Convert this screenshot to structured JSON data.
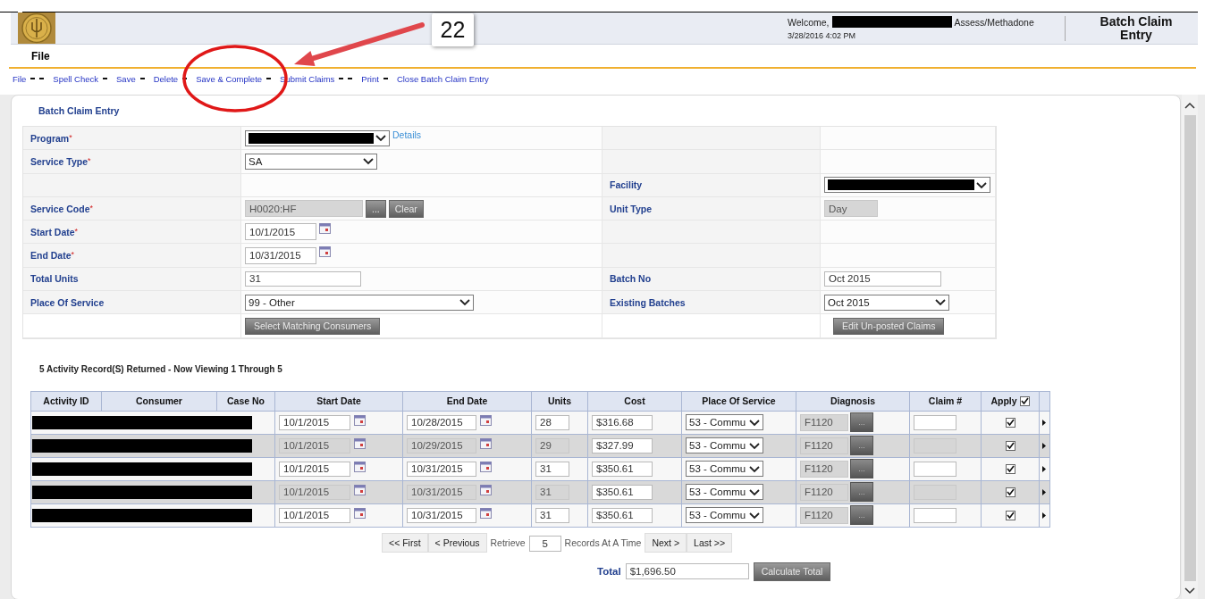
{
  "header": {
    "welcome": "Welcome,",
    "role": "Assess/Methadone",
    "datetime": "3/28/2016 4:02 PM",
    "page_title": "Batch Claim Entry"
  },
  "menu_bar": {
    "label": "File"
  },
  "toolbar": [
    {
      "label": "File",
      "kind": "double"
    },
    {
      "label": "Spell Check",
      "kind": "single"
    },
    {
      "label": "Save",
      "kind": "single"
    },
    {
      "label": "Delete",
      "kind": "single"
    },
    {
      "label": "Save & Complete",
      "kind": "single"
    },
    {
      "label": "Submit Claims",
      "kind": "double"
    },
    {
      "label": "Print",
      "kind": "single"
    },
    {
      "label": "Close Batch Claim Entry",
      "kind": "plain"
    }
  ],
  "annotation": {
    "callout": "22"
  },
  "form": {
    "title": "Batch Claim Entry",
    "rows": [
      {
        "left": {
          "label": "Program",
          "required_mark": "*",
          "control": {
            "kind": "redacted-select",
            "link": "Details"
          }
        }
      },
      {
        "left": {
          "label": "Service Type",
          "required_mark": "*",
          "control": {
            "kind": "select",
            "value": "SA"
          }
        }
      },
      {
        "right": {
          "label": "Facility",
          "control": {
            "kind": "redacted-select"
          }
        }
      },
      {
        "left": {
          "label": "Service Code",
          "required_mark": "*",
          "control": {
            "kind": "lookup",
            "value": "H0020:HF",
            "buttons": [
              "...",
              "Clear"
            ]
          }
        },
        "right": {
          "label": "Unit Type",
          "control": {
            "kind": "readonly",
            "value": "Day"
          }
        }
      },
      {
        "left": {
          "label": "Start Date",
          "required_mark": "*",
          "control": {
            "kind": "date",
            "value": "10/1/2015"
          }
        }
      },
      {
        "left": {
          "label": "End Date",
          "required_mark": "*",
          "control": {
            "kind": "date",
            "value": "10/31/2015"
          }
        }
      },
      {
        "left": {
          "label": "Total Units",
          "control": {
            "kind": "text",
            "value": "31"
          }
        },
        "right": {
          "label": "Batch No",
          "control": {
            "kind": "text",
            "value": "Oct 2015"
          }
        }
      },
      {
        "left": {
          "label": "Place Of Service",
          "control": {
            "kind": "select",
            "value": "99 - Other"
          }
        },
        "right": {
          "label": "Existing Batches",
          "control": {
            "kind": "select",
            "value": "Oct 2015"
          }
        }
      },
      {
        "left": {
          "control": {
            "kind": "button",
            "value": "Select Matching Consumers"
          }
        },
        "right": {
          "control": {
            "kind": "button",
            "value": "Edit Un-posted Claims"
          }
        }
      }
    ]
  },
  "records_summary": "5 Activity Record(S) Returned - Now Viewing 1 Through 5",
  "grid": {
    "columns": [
      "Activity ID",
      "Consumer",
      "Case No",
      "Start Date",
      "End Date",
      "Units",
      "Cost",
      "Place Of Service",
      "Diagnosis",
      "Claim #",
      "Apply"
    ],
    "apply_all_checked": true,
    "rows": [
      {
        "start_date": "10/1/2015",
        "end_date": "10/28/2015",
        "units": "28",
        "cost": "$316.68",
        "place_of_service": "53 - Commu",
        "diagnosis": "F1120",
        "diagnosis_button": "...",
        "applied": true
      },
      {
        "start_date": "10/1/2015",
        "end_date": "10/29/2015",
        "units": "29",
        "cost": "$327.99",
        "place_of_service": "53 - Commu",
        "diagnosis": "F1120",
        "diagnosis_button": "...",
        "applied": true
      },
      {
        "start_date": "10/1/2015",
        "end_date": "10/31/2015",
        "units": "31",
        "cost": "$350.61",
        "place_of_service": "53 - Commu",
        "diagnosis": "F1120",
        "diagnosis_button": "...",
        "applied": true
      },
      {
        "start_date": "10/1/2015",
        "end_date": "10/31/2015",
        "units": "31",
        "cost": "$350.61",
        "place_of_service": "53 - Commu",
        "diagnosis": "F1120",
        "diagnosis_button": "...",
        "applied": true
      },
      {
        "start_date": "10/1/2015",
        "end_date": "10/31/2015",
        "units": "31",
        "cost": "$350.61",
        "place_of_service": "53 - Commu",
        "diagnosis": "F1120",
        "diagnosis_button": "...",
        "applied": true
      }
    ]
  },
  "pager": {
    "first": "<< First",
    "previous": "< Previous",
    "retrieve_label": "Retrieve",
    "page_size": "5",
    "page_size_suffix": "Records At A Time",
    "next": "Next >",
    "last": "Last >>"
  },
  "totals": {
    "label": "Total",
    "value": "$1,696.50",
    "button": "Calculate Total"
  }
}
